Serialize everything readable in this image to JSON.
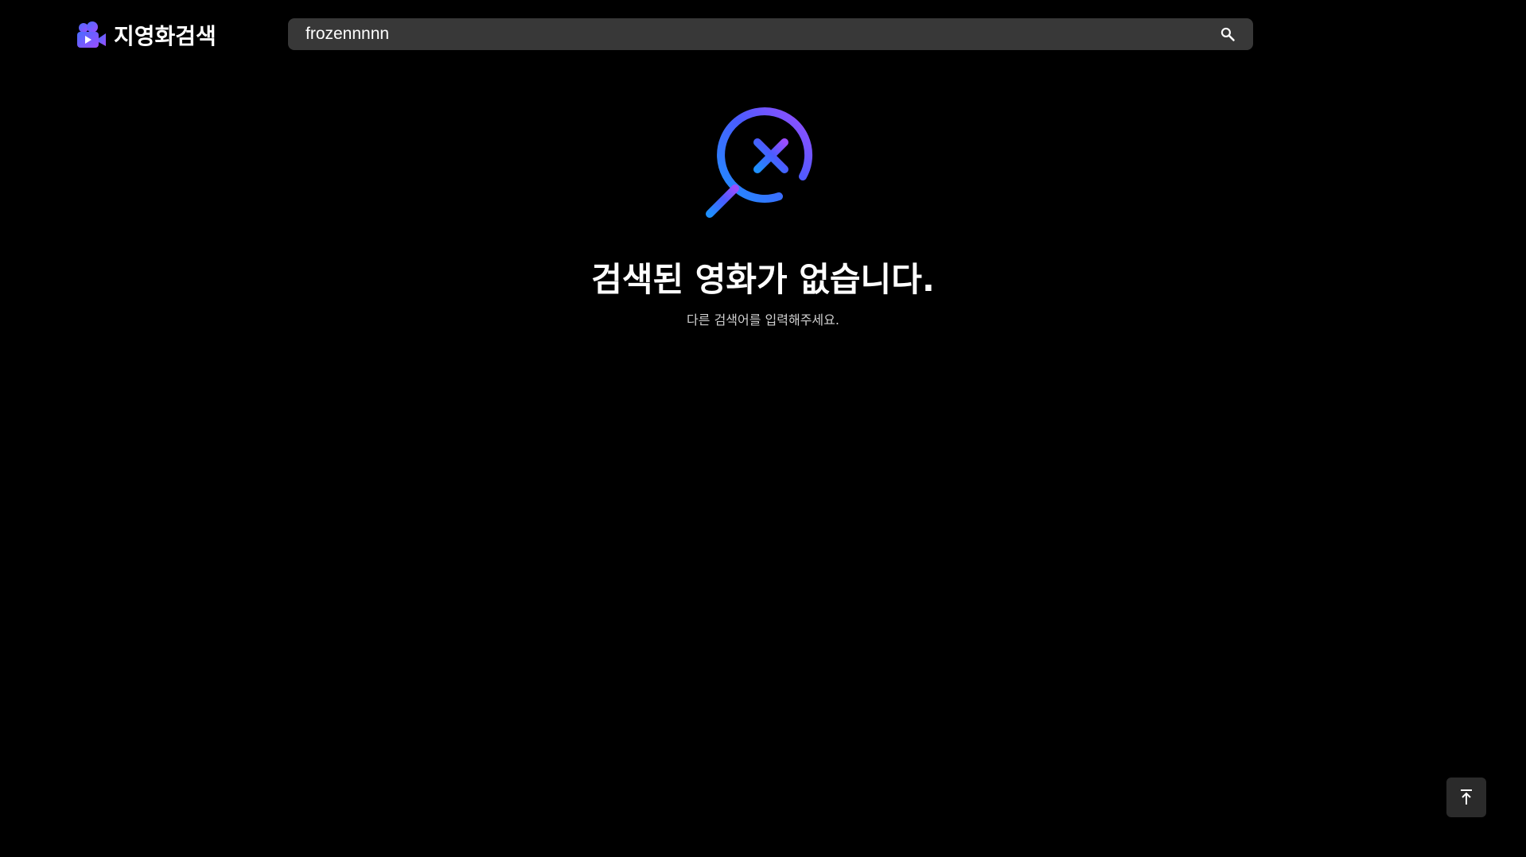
{
  "header": {
    "logo_text": "지영화검색",
    "logo_icon": "movie-camera-icon"
  },
  "search": {
    "value": "frozennnnn",
    "placeholder": "",
    "button_icon": "search-icon"
  },
  "empty_state": {
    "icon": "search-x-icon",
    "title": "검색된 영화가 없습니다.",
    "subtitle": "다른 검색어를 입력해주세요."
  },
  "scroll_top": {
    "icon": "arrow-to-top-icon"
  },
  "colors": {
    "background": "#000000",
    "search_bg": "#383838",
    "gradient_start": "#1e90ff",
    "gradient_mid": "#4a5cff",
    "gradient_end": "#9b4dff",
    "scroll_button_bg": "#2b2b2b"
  }
}
